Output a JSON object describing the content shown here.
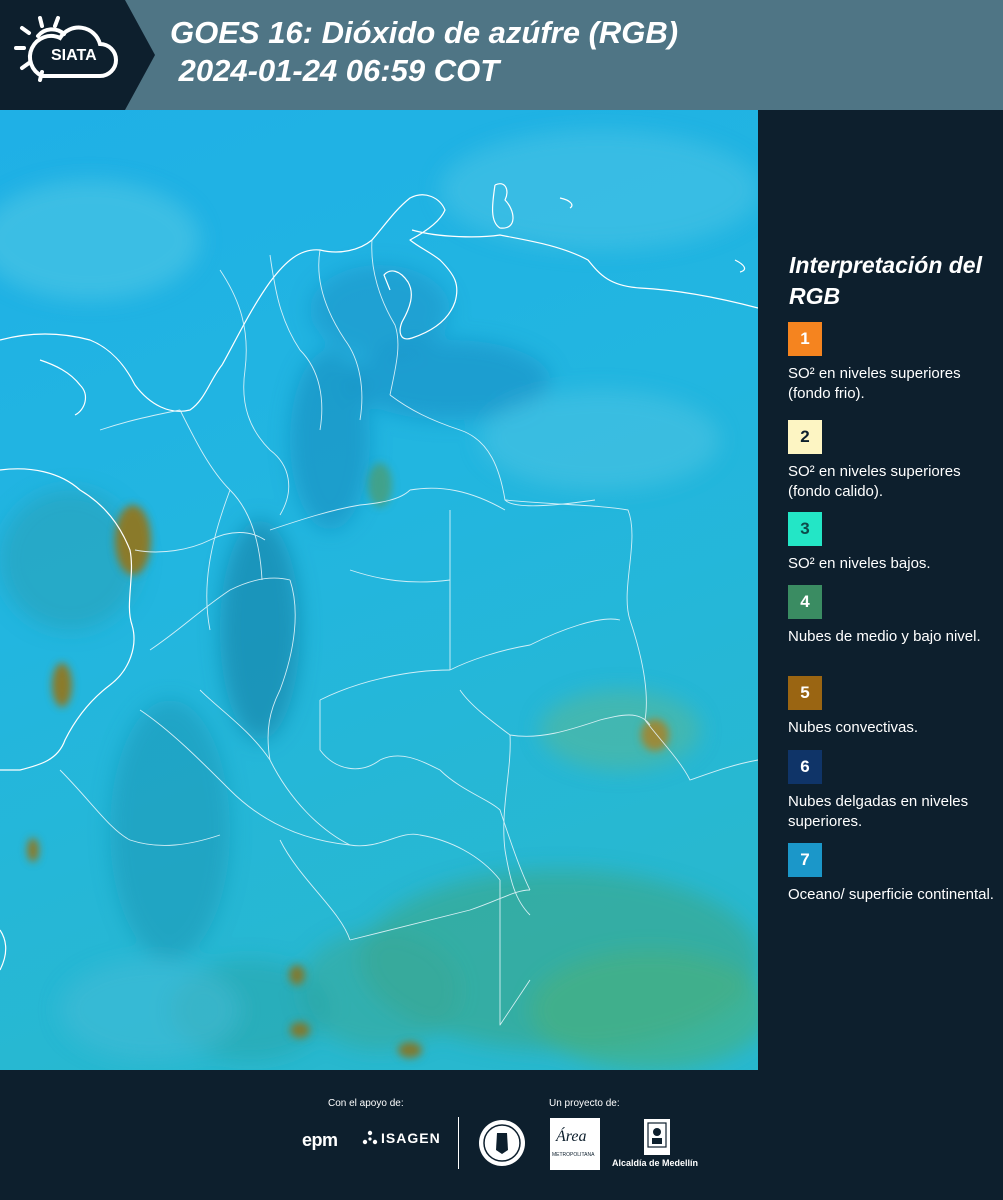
{
  "header": {
    "logo_text": "SIATA",
    "title_line1": "GOES 16: Dióxido de azúfre (RGB)",
    "title_line2": " 2024-01-24 06:59 COT",
    "background_color": "#4f7585"
  },
  "legend": {
    "title": "Interpretación del RGB",
    "items": [
      {
        "number": "1",
        "label": "SO² en niveles superiores (fondo frio).",
        "color": "#f5841f"
      },
      {
        "number": "2",
        "label": "SO² en niveles superiores (fondo calido).",
        "color": "#fdf5c3"
      },
      {
        "number": "3",
        "label": "SO² en niveles bajos.",
        "color": "#23e6c6"
      },
      {
        "number": "4",
        "label": "Nubes de medio y bajo nivel.",
        "color": "#3a8c62"
      },
      {
        "number": "5",
        "label": "Nubes convectivas.",
        "color": "#9a6512"
      },
      {
        "number": "6",
        "label": "Nubes delgadas en niveles superiores.",
        "color": "#0f3468"
      },
      {
        "number": "7",
        "label": "Oceano/ superficie continental.",
        "color": "#1b97c9"
      }
    ]
  },
  "footer": {
    "support_label": "Con el apoyo de:",
    "project_label": "Un proyecto de:",
    "sponsors": [
      "epm",
      "ISAGEN"
    ],
    "partners": [
      "Universidad Nacional de Colombia Sede Medellín",
      "Área Metropolitana Valle de Aburrá",
      "Alcaldía de Medellín"
    ],
    "epm_text": "epm",
    "isagen_text": "ISAGEN",
    "area_text": "Área",
    "area_subtext": "METROPOLITANA",
    "alcaldia_text": "Alcaldía de Medellín"
  }
}
